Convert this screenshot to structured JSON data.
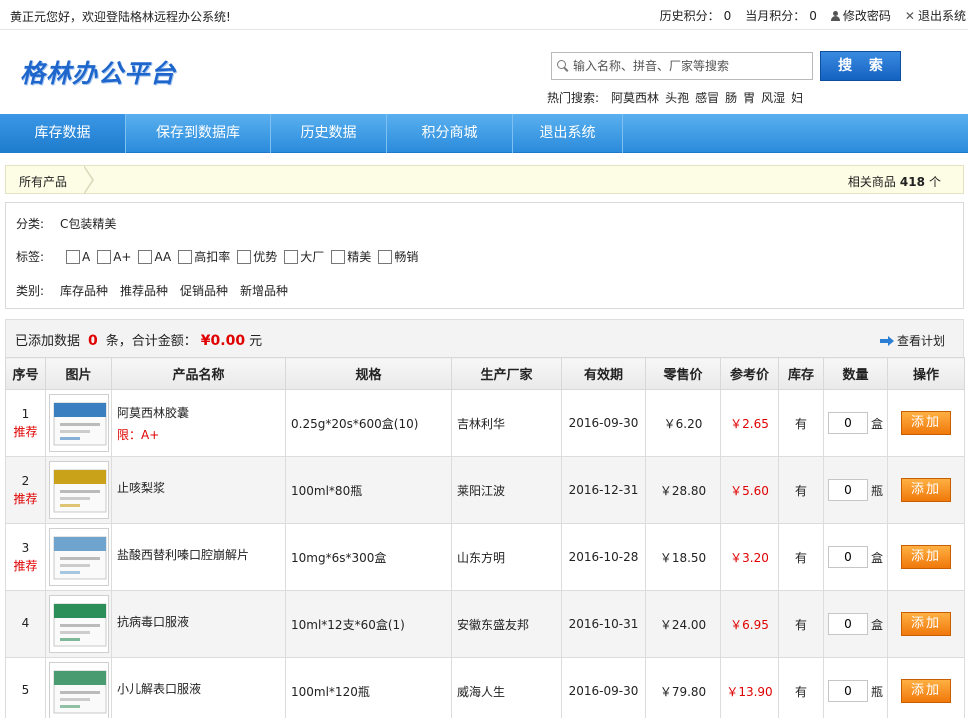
{
  "topbar": {
    "greeting": "黄正元您好，欢迎登陆格林远程办公系统!",
    "history_points_label": "历史积分：",
    "history_points": "0",
    "month_points_label": "当月积分：",
    "month_points": "0",
    "change_password": "修改密码",
    "logout": "退出系统"
  },
  "header": {
    "logo": "格林办公平台",
    "search_placeholder": "输入名称、拼音、厂家等搜索",
    "search_button": "搜 索",
    "hot_label": "热门搜索:",
    "hot_keywords": [
      "阿莫西林",
      "头孢",
      "感冒",
      "肠",
      "胃",
      "风湿",
      "妇"
    ]
  },
  "nav": {
    "items": [
      "库存数据",
      "保存到数据库",
      "历史数据",
      "积分商城",
      "退出系统"
    ],
    "active_index": 0
  },
  "crumb": {
    "all_products": "所有产品",
    "related_label": "相关商品",
    "related_count": "418",
    "related_unit": "个"
  },
  "filters": {
    "category_label": "分类:",
    "category_value": "C包装精美",
    "tags_label": "标签:",
    "tags": [
      "A",
      "A+",
      "AA",
      "高扣率",
      "优势",
      "大厂",
      "精美",
      "畅销"
    ],
    "type_label": "类别:",
    "types": [
      "库存品种",
      "推荐品种",
      "促销品种",
      "新增品种"
    ]
  },
  "summary": {
    "prefix": "已添加数据",
    "count": "0",
    "middle": "条，合计金额：",
    "amount": "¥0.00",
    "suffix": "元",
    "view_plan": "查看计划"
  },
  "table": {
    "headers": [
      "序号",
      "图片",
      "产品名称",
      "规格",
      "生产厂家",
      "有效期",
      "零售价",
      "参考价",
      "库存",
      "数量",
      "操作"
    ],
    "rows": [
      {
        "seq": "1",
        "rec": "推荐",
        "name": "阿莫西林胶囊",
        "limit": "限：A+",
        "spec": "0.25g*20s*600盒(10)",
        "maker": "吉林利华",
        "expiry": "2016-09-30",
        "retail": "￥6.20",
        "ref": "￥2.65",
        "stock": "有",
        "qty": "0",
        "unit": "盒",
        "action": "添加",
        "thumb_color": "#3a7fc0"
      },
      {
        "seq": "2",
        "rec": "推荐",
        "name": "止咳梨浆",
        "limit": "",
        "spec": "100ml*80瓶",
        "maker": "莱阳江波",
        "expiry": "2016-12-31",
        "retail": "￥28.80",
        "ref": "￥5.60",
        "stock": "有",
        "qty": "0",
        "unit": "瓶",
        "action": "添加",
        "thumb_color": "#c9a21a"
      },
      {
        "seq": "3",
        "rec": "推荐",
        "name": "盐酸西替利嗪口腔崩解片",
        "limit": "",
        "spec": "10mg*6s*300盒",
        "maker": "山东方明",
        "expiry": "2016-10-28",
        "retail": "￥18.50",
        "ref": "￥3.20",
        "stock": "有",
        "qty": "0",
        "unit": "盒",
        "action": "添加",
        "thumb_color": "#6fa4cf"
      },
      {
        "seq": "4",
        "rec": "",
        "name": "抗病毒口服液",
        "limit": "",
        "spec": "10ml*12支*60盒(1)",
        "maker": "安徽东盛友邦",
        "expiry": "2016-10-31",
        "retail": "￥24.00",
        "ref": "￥6.95",
        "stock": "有",
        "qty": "0",
        "unit": "盒",
        "action": "添加",
        "thumb_color": "#2c8f5a"
      },
      {
        "seq": "5",
        "rec": "",
        "name": "小儿解表口服液",
        "limit": "",
        "spec": "100ml*120瓶",
        "maker": "威海人生",
        "expiry": "2016-09-30",
        "retail": "￥79.80",
        "ref": "￥13.90",
        "stock": "有",
        "qty": "0",
        "unit": "瓶",
        "action": "添加",
        "thumb_color": "#4a9b6f"
      }
    ]
  }
}
